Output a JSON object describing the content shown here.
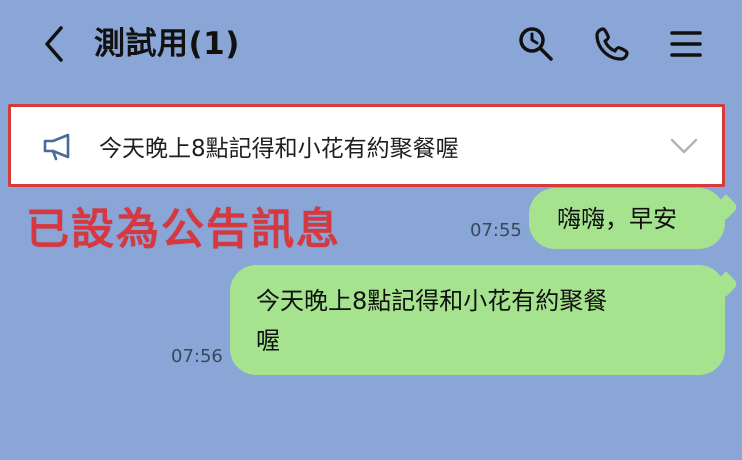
{
  "header": {
    "title": "測試用(1)",
    "icons": [
      "back-icon",
      "search-icon",
      "phone-icon",
      "menu-icon"
    ]
  },
  "announcement": {
    "icon": "megaphone-icon",
    "text": "今天晚上8點記得和小花有約聚餐喔",
    "expand_icon": "chevron-down-icon"
  },
  "caption": {
    "text": "已設為公告訊息",
    "color": "#d7373f"
  },
  "messages": [
    {
      "time": "07:55",
      "text": "嗨嗨，早安"
    },
    {
      "time": "07:56",
      "line1": "今天晚上8點記得和小花有約聚餐",
      "line2": "喔"
    }
  ],
  "colors": {
    "background": "#8aa6d7",
    "bubble": "#a6e38f",
    "highlight_border": "#d83a3a"
  }
}
